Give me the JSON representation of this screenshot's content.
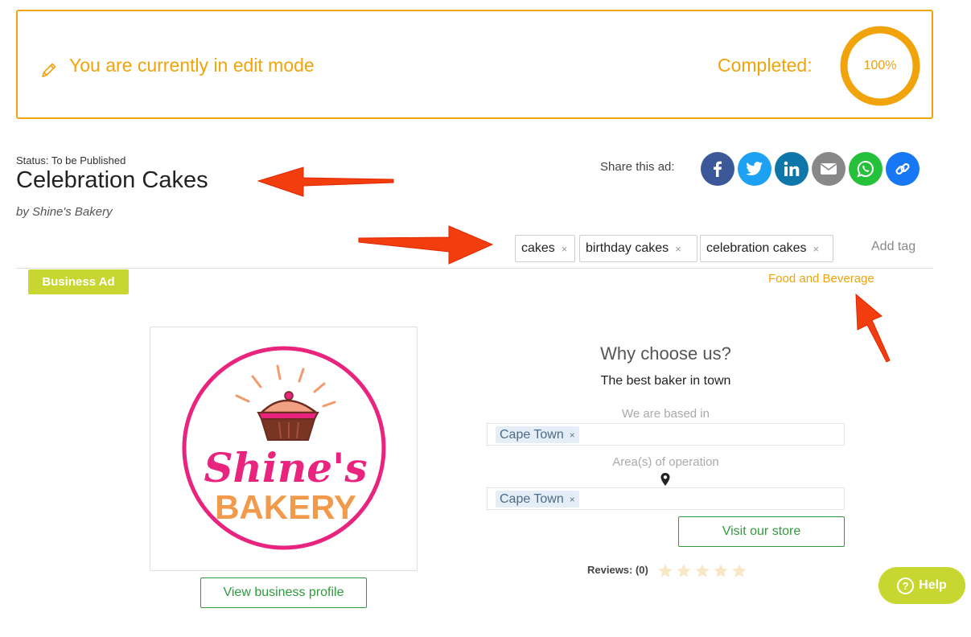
{
  "banner": {
    "edit_mode_text": "You are currently in edit mode",
    "completed_label": "Completed:",
    "progress_text": "100%",
    "progress_fraction": 1.0,
    "accent_color": "#f0a30a"
  },
  "ad": {
    "status": "Status: To be Published",
    "title": "Celebration Cakes",
    "byline": "by Shine's Bakery"
  },
  "share": {
    "label": "Share this ad:",
    "buttons": [
      {
        "icon": "facebook-icon",
        "color": "#3b5998"
      },
      {
        "icon": "twitter-icon",
        "color": "#1da1f2"
      },
      {
        "icon": "linkedin-icon",
        "color": "#0e76a8"
      },
      {
        "icon": "email-icon",
        "color": "#888888"
      },
      {
        "icon": "whatsapp-icon",
        "color": "#25c13b"
      },
      {
        "icon": "link-icon",
        "color": "#1877f2"
      }
    ]
  },
  "tags": {
    "items": [
      "cakes",
      "birthday cakes",
      "celebration cakes"
    ],
    "remove_glyph": "×",
    "add_label": "Add tag"
  },
  "badge": {
    "label": "Business Ad",
    "color": "#c8d631"
  },
  "category": {
    "label": "Food and Beverage"
  },
  "logo": {
    "line1": "Shine's",
    "line2": "BAKERY"
  },
  "buttons": {
    "view_profile": "View business profile",
    "visit_store": "Visit our store"
  },
  "why": {
    "heading": "Why choose us?",
    "subtitle": "The best baker in town",
    "based_label": "We are based in",
    "based_value": "Cape Town",
    "area_label": "Area(s) of operation",
    "area_value": "Cape Town",
    "remove_glyph": "×"
  },
  "reviews": {
    "label": "Reviews: (0)",
    "rating": 0,
    "max": 5
  },
  "help": {
    "label": "Help",
    "glyph": "?"
  }
}
